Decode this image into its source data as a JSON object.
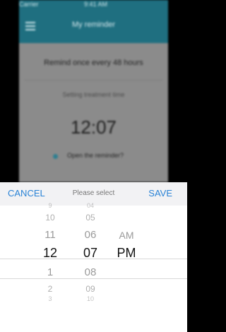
{
  "statusbar": {
    "carrier": "Carrier",
    "clock": "9:41 AM"
  },
  "app": {
    "title": "My reminder",
    "remind_text": "Remind once every 48 hours",
    "setting_label": "Setting treatment time",
    "time": "12:07",
    "open_label": "Open the reminder?"
  },
  "picker": {
    "cancel": "CANCEL",
    "title": "Please select",
    "save": "SAVE",
    "hours": [
      "9",
      "10",
      "11",
      "12",
      "1",
      "2",
      "3"
    ],
    "minutes": [
      "04",
      "05",
      "06",
      "07",
      "08",
      "09",
      "10"
    ],
    "ampm": [
      "AM",
      "PM"
    ],
    "selected": {
      "hour": "12",
      "minute": "07",
      "ampm": "PM"
    }
  },
  "colors": {
    "accent": "#2a83d6",
    "appbar": "#1f6f80"
  }
}
